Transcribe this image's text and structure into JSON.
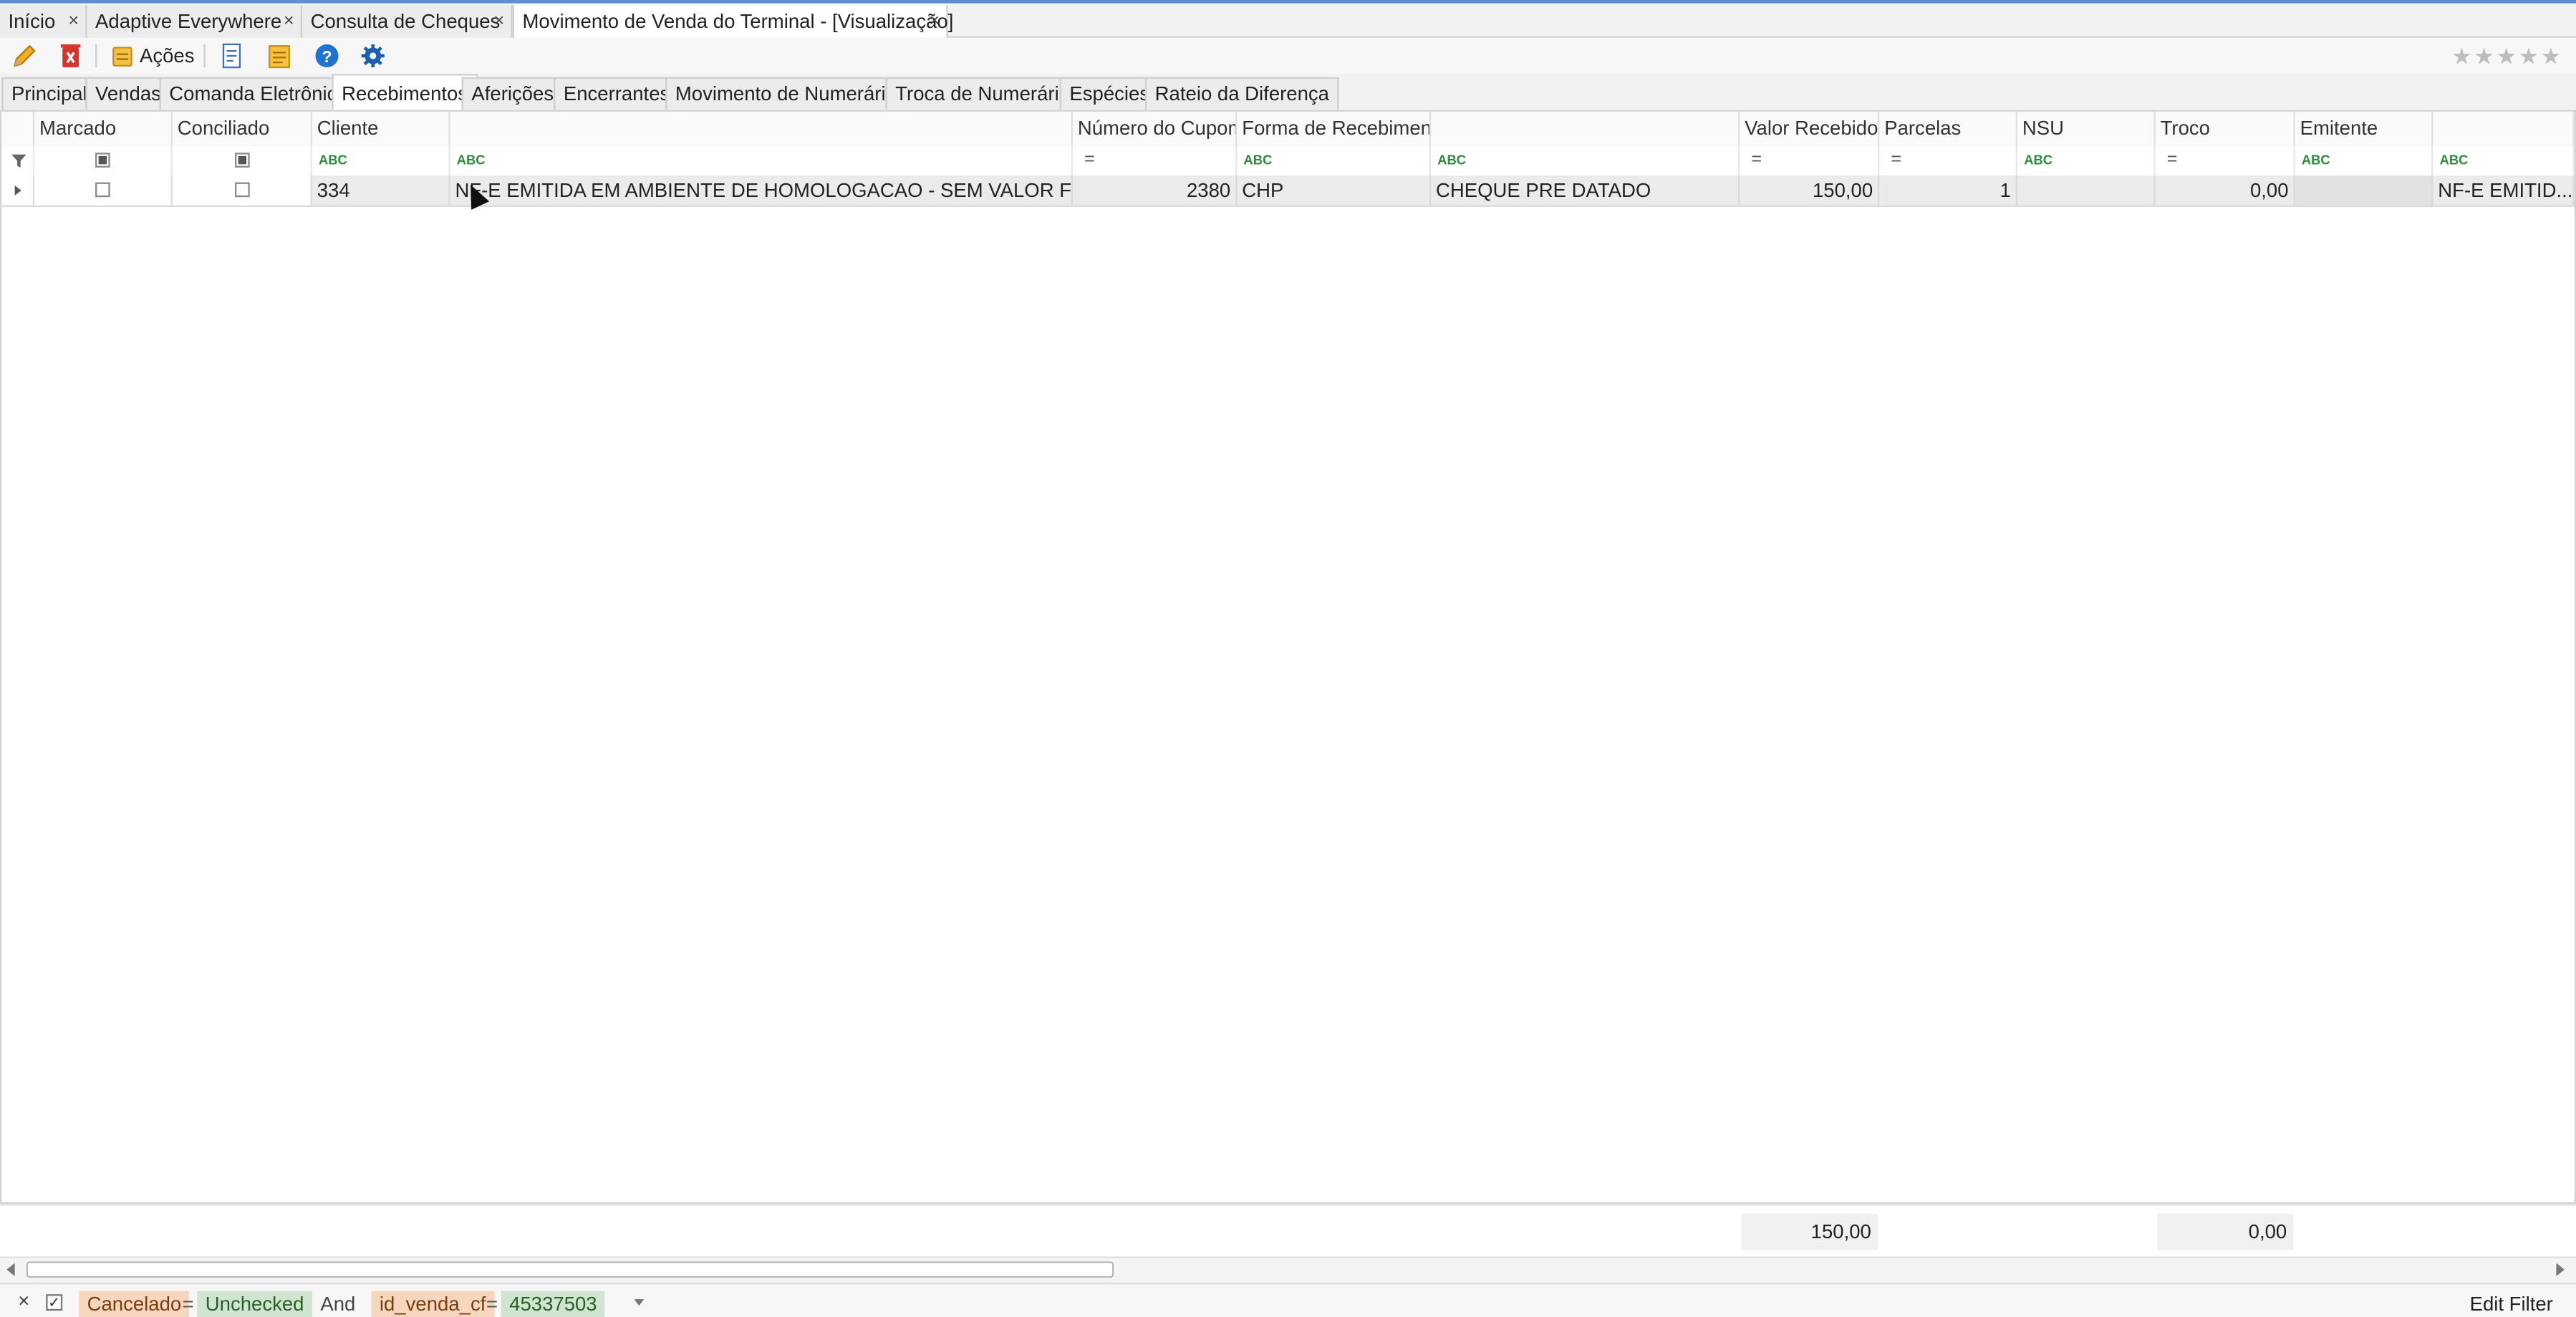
{
  "doc_tabs": [
    {
      "label": "Início"
    },
    {
      "label": "Adaptive Everywhere"
    },
    {
      "label": "Consulta de Cheques"
    },
    {
      "label": "Movimento de Venda do Terminal - [Visualização]"
    }
  ],
  "toolbar": {
    "actions_label": "Ações"
  },
  "section_tabs": [
    "Principal",
    "Vendas",
    "Comanda Eletrônica",
    "Recebimentos",
    "Aferições",
    "Encerrantes",
    "Movimento de Numerário",
    "Troca de Numerário",
    "Espécies",
    "Rateio da Diferença"
  ],
  "active_section_tab": "Recebimentos",
  "grid": {
    "columns": [
      "Marcado",
      "Conciliado",
      "Cliente",
      "",
      "Número do Cupom",
      "Forma de Recebimento",
      "",
      "Valor Recebido",
      "Parcelas",
      "NSU",
      "Troco",
      "Emitente",
      ""
    ],
    "row": {
      "cliente": "334",
      "cliente_nome": "NF-E EMITIDA EM AMBIENTE DE HOMOLOGACAO - SEM VALOR FISCAL",
      "numero_cupom": "2380",
      "forma": "CHP",
      "forma_desc": "CHEQUE PRE DATADO",
      "valor_recebido": "150,00",
      "parcelas": "1",
      "nsu": "",
      "troco": "0,00",
      "emitente": "",
      "emitente_nome": "NF-E EMITID..."
    },
    "totals": {
      "valor_recebido": "150,00",
      "troco": "0,00"
    }
  },
  "filter": {
    "field1": "Cancelado",
    "op1": "=",
    "value1": "Unchecked",
    "logic": "And",
    "field2": "id_venda_cf",
    "op2": "=",
    "value2": "45337503",
    "edit_label": "Edit Filter"
  },
  "colors": {
    "accent": "#5b8fd0",
    "filter_field": "#f6d6bd",
    "filter_value": "#cfe5cf"
  }
}
